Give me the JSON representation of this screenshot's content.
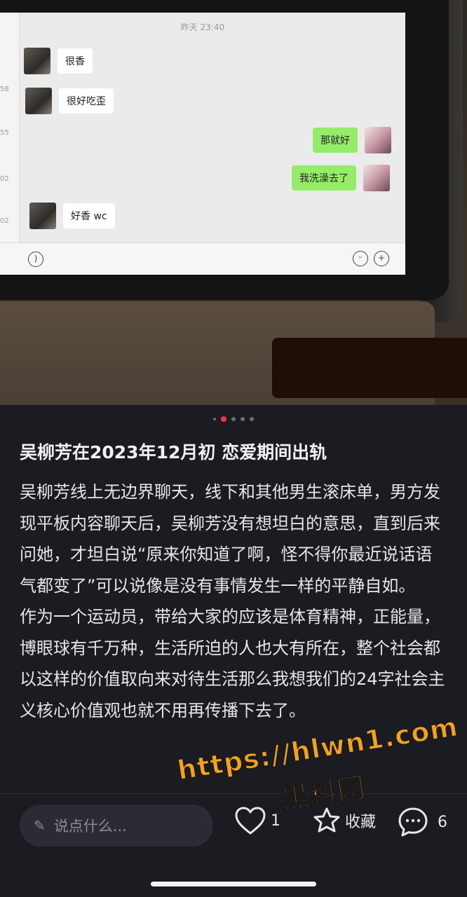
{
  "photo": {
    "chat_time": "昨天 23:40",
    "left_strip": [
      "58",
      "55",
      "02",
      "02"
    ],
    "messages": [
      {
        "side": "left",
        "text": "很香"
      },
      {
        "side": "left",
        "text": "很好吃歪"
      },
      {
        "side": "right",
        "text": "那就好"
      },
      {
        "side": "right",
        "text": "我洗澡去了"
      },
      {
        "side": "left",
        "text": "好香 wc"
      }
    ],
    "input_icons": [
      "voice-icon",
      "emoji-icon",
      "plus-icon"
    ]
  },
  "pager": {
    "count": 5,
    "active_index": 1
  },
  "post": {
    "title": "吴柳芳在2023年12月初 恋爱期间出轨",
    "paragraphs": [
      "吴柳芳线上无边界聊天，线下和其他男生滚床单，男方发现平板内容聊天后，吴柳芳没有想坦白的意思，直到后来问她，才坦白说“原来你知道了啊，怪不得你最近说话语气都变了”可以说像是没有事情发生一样的平静自如。",
      "作为一个运动员，带给大家的应该是体育精神，正能量，博眼球有千万种，生活所迫的人也大有所在，整个社会都以这样的价值取向来对待生活那么我想我们的24字社会主义核心价值观也就不用再传播下去了。"
    ]
  },
  "bottom_bar": {
    "comment_placeholder": "说点什么...",
    "like_count": "1",
    "collect_label": "收藏",
    "comment_count": "6"
  },
  "watermark": {
    "url": "https://hlwn1.com",
    "name": "黑料网"
  },
  "colors": {
    "background": "#1b1b22",
    "accent_dot": "#ff2e4d",
    "watermark": "#f5a21b",
    "wechat_green": "#95ec69"
  }
}
